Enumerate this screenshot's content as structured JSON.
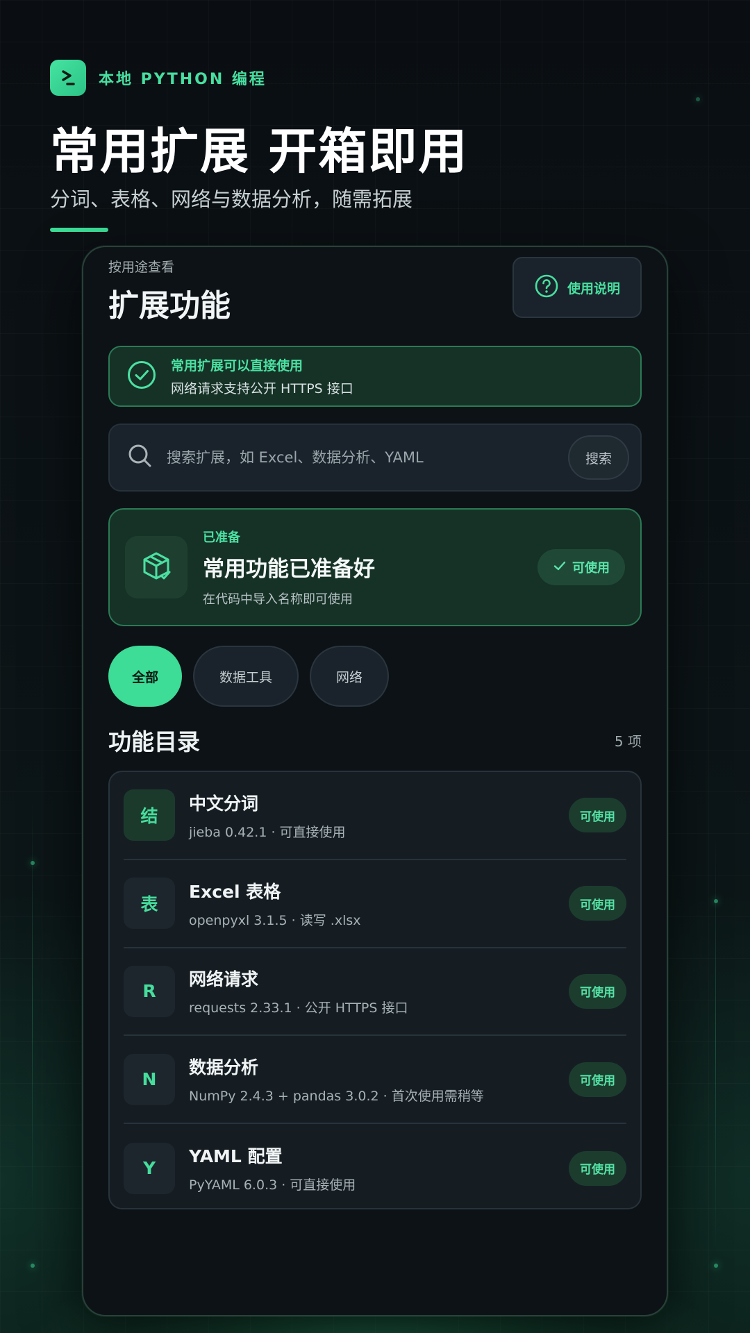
{
  "brand": {
    "label": "本地 PYTHON 编程",
    "logo_icon": "terminal-prompt-icon"
  },
  "hero": {
    "title": "常用扩展 开箱即用",
    "subtitle": "分词、表格、网络与数据分析，随需拓展"
  },
  "page": {
    "eyebrow": "按用途查看",
    "title": "扩展功能",
    "help_label": "使用说明",
    "help_icon": "question-circle-icon"
  },
  "notice": {
    "title": "常用扩展可以直接使用",
    "text": "网络请求支持公开 HTTPS 接口",
    "icon": "check-circle-icon"
  },
  "search": {
    "placeholder": "搜索扩展，如 Excel、数据分析、YAML",
    "button": "搜索",
    "icon": "search-icon"
  },
  "ready": {
    "tag": "已准备",
    "title": "常用功能已准备好",
    "desc": "在代码中导入名称即可使用",
    "pill": "可使用",
    "icon": "package-check-icon"
  },
  "filters": [
    "全部",
    "数据工具",
    "网络"
  ],
  "catalog": {
    "title": "功能目录",
    "count": "5 项",
    "items": [
      {
        "icon": "结",
        "title": "中文分词",
        "sub": "jieba 0.42.1 · 可直接使用",
        "badge": "可使用"
      },
      {
        "icon": "表",
        "title": "Excel 表格",
        "sub": "openpyxl 3.1.5 · 读写 .xlsx",
        "badge": "可使用"
      },
      {
        "icon": "R",
        "title": "网络请求",
        "sub": "requests 2.33.1 · 公开 HTTPS 接口",
        "badge": "可使用"
      },
      {
        "icon": "N",
        "title": "数据分析",
        "sub": "NumPy 2.4.3 + pandas 3.0.2 · 首次使用需稍等",
        "badge": "可使用"
      },
      {
        "icon": "Y",
        "title": "YAML 配置",
        "sub": "PyYAML 6.0.3 · 可直接使用",
        "badge": "可使用"
      }
    ]
  },
  "colors": {
    "accent": "#3ddc97",
    "background": "#0b1014",
    "card": "#163226"
  }
}
